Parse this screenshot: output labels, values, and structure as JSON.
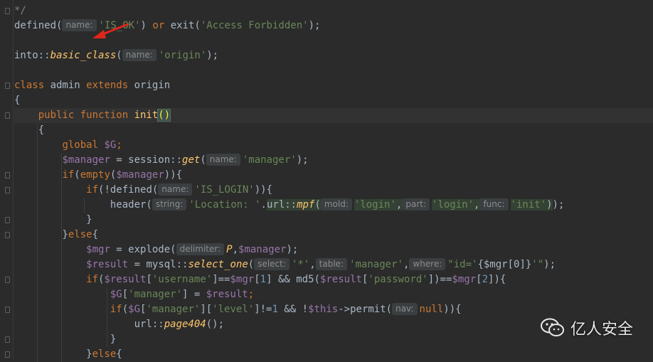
{
  "watermark": {
    "text": "亿人安全",
    "icon": "wechat-icon"
  },
  "colors": {
    "background": "#2b2b2b",
    "keyword": "#cc7832",
    "string": "#6a8759",
    "variable": "#9876aa",
    "function": "#ffc66d",
    "hint_bg": "#3b3f41",
    "arrow": "#e0261b"
  },
  "lines": [
    {
      "tokens": [
        {
          "t": "*/",
          "c": "cm"
        }
      ]
    },
    {
      "tokens": [
        {
          "t": "defined(",
          "c": "plain"
        },
        {
          "h": "name:"
        },
        {
          "t": "'IS_OK'",
          "c": "str"
        },
        {
          "t": ") ",
          "c": "plain"
        },
        {
          "t": "or ",
          "c": "kw"
        },
        {
          "t": "exit(",
          "c": "plain"
        },
        {
          "t": "'Access Forbidden'",
          "c": "str"
        },
        {
          "t": ");",
          "c": "plain"
        }
      ]
    },
    {
      "tokens": []
    },
    {
      "tokens": [
        {
          "t": "into::",
          "c": "plain"
        },
        {
          "t": "basic_class",
          "c": "ital"
        },
        {
          "t": "(",
          "c": "plain"
        },
        {
          "h": "name:"
        },
        {
          "t": "'origin'",
          "c": "str"
        },
        {
          "t": ");",
          "c": "plain"
        }
      ]
    },
    {
      "tokens": []
    },
    {
      "tokens": [
        {
          "t": "class ",
          "c": "kw"
        },
        {
          "t": "admin ",
          "c": "plain"
        },
        {
          "t": "extends ",
          "c": "kw"
        },
        {
          "t": "origin",
          "c": "plain"
        }
      ]
    },
    {
      "tokens": [
        {
          "t": "{",
          "c": "plain"
        }
      ]
    },
    {
      "current": true,
      "tokens": [
        {
          "t": "    ",
          "c": "plain"
        },
        {
          "t": "public function ",
          "c": "kw"
        },
        {
          "t": "init",
          "c": "fn"
        },
        {
          "t": "()",
          "c": "paren"
        }
      ]
    },
    {
      "tokens": [
        {
          "t": "    {",
          "c": "plain"
        }
      ]
    },
    {
      "tokens": [
        {
          "t": "        ",
          "c": "plain"
        },
        {
          "t": "global ",
          "c": "kw"
        },
        {
          "t": "$G",
          "c": "var"
        },
        {
          "t": ";",
          "c": "kw"
        }
      ]
    },
    {
      "tokens": [
        {
          "t": "        ",
          "c": "plain"
        },
        {
          "t": "$manager",
          "c": "var"
        },
        {
          "t": " = session::",
          "c": "plain"
        },
        {
          "t": "get",
          "c": "ital"
        },
        {
          "t": "(",
          "c": "plain"
        },
        {
          "h": "name:"
        },
        {
          "t": "'manager'",
          "c": "str"
        },
        {
          "t": ");",
          "c": "plain"
        }
      ]
    },
    {
      "tokens": [
        {
          "t": "        ",
          "c": "plain"
        },
        {
          "t": "if",
          "c": "kw"
        },
        {
          "t": "(",
          "c": "plain"
        },
        {
          "t": "empty",
          "c": "kw"
        },
        {
          "t": "(",
          "c": "plain"
        },
        {
          "t": "$manager",
          "c": "var"
        },
        {
          "t": ")){",
          "c": "plain"
        }
      ]
    },
    {
      "tokens": [
        {
          "t": "            ",
          "c": "plain"
        },
        {
          "t": "if",
          "c": "kw"
        },
        {
          "t": "(!defined(",
          "c": "plain"
        },
        {
          "h": "name:"
        },
        {
          "t": "'IS_LOGIN'",
          "c": "str"
        },
        {
          "t": ")){",
          "c": "plain"
        }
      ]
    },
    {
      "tokens": [
        {
          "t": "                header(",
          "c": "plain"
        },
        {
          "h": "string:"
        },
        {
          "t": "'Location: '",
          "c": "str"
        },
        {
          "t": ".",
          "c": "plain"
        },
        {
          "t": "url::",
          "c": "hlplain"
        },
        {
          "t": "mpf",
          "c": "hlital"
        },
        {
          "t": "(",
          "c": "hlplain"
        },
        {
          "h": "mold:"
        },
        {
          "t": "'login'",
          "c": "hlstr"
        },
        {
          "t": ",",
          "c": "hlplain"
        },
        {
          "h": "part:"
        },
        {
          "t": "'login'",
          "c": "hlstr"
        },
        {
          "t": ",",
          "c": "hlplain"
        },
        {
          "h": "func:"
        },
        {
          "t": "'init'",
          "c": "hlstr"
        },
        {
          "t": ")",
          "c": "hlplain"
        },
        {
          "t": ");",
          "c": "plain"
        }
      ]
    },
    {
      "tokens": [
        {
          "t": "            }",
          "c": "plain"
        }
      ]
    },
    {
      "tokens": [
        {
          "t": "        }",
          "c": "plain"
        },
        {
          "t": "else",
          "c": "kw"
        },
        {
          "t": "{",
          "c": "plain"
        }
      ]
    },
    {
      "tokens": [
        {
          "t": "            ",
          "c": "plain"
        },
        {
          "t": "$mgr",
          "c": "var"
        },
        {
          "t": " = explode(",
          "c": "plain"
        },
        {
          "h": "delimiter:"
        },
        {
          "t": "P",
          "c": "ital"
        },
        {
          "t": ",",
          "c": "plain"
        },
        {
          "t": "$manager",
          "c": "var"
        },
        {
          "t": ");",
          "c": "plain"
        }
      ]
    },
    {
      "tokens": [
        {
          "t": "            ",
          "c": "plain"
        },
        {
          "t": "$result",
          "c": "var"
        },
        {
          "t": " = mysql::",
          "c": "plain"
        },
        {
          "t": "select_one",
          "c": "ital"
        },
        {
          "t": "(",
          "c": "plain"
        },
        {
          "h": "select:"
        },
        {
          "t": "'*'",
          "c": "str"
        },
        {
          "t": ",",
          "c": "plain"
        },
        {
          "h": "table:"
        },
        {
          "t": "'manager'",
          "c": "str"
        },
        {
          "t": ",",
          "c": "plain"
        },
        {
          "h": "where:"
        },
        {
          "t": "\"id='",
          "c": "str"
        },
        {
          "t": "{$mgr[0]}",
          "c": "plain"
        },
        {
          "t": "'\"",
          "c": "str"
        },
        {
          "t": ");",
          "c": "plain"
        }
      ]
    },
    {
      "tokens": [
        {
          "t": "            ",
          "c": "plain"
        },
        {
          "t": "if",
          "c": "kw"
        },
        {
          "t": "(",
          "c": "plain"
        },
        {
          "t": "$result",
          "c": "var"
        },
        {
          "t": "[",
          "c": "plain"
        },
        {
          "t": "'username'",
          "c": "str"
        },
        {
          "t": "]==",
          "c": "plain"
        },
        {
          "t": "$mgr",
          "c": "var"
        },
        {
          "t": "[",
          "c": "plain"
        },
        {
          "t": "1",
          "c": "num"
        },
        {
          "t": "] && md5(",
          "c": "plain"
        },
        {
          "t": "$result",
          "c": "var"
        },
        {
          "t": "[",
          "c": "plain"
        },
        {
          "t": "'password'",
          "c": "str"
        },
        {
          "t": "])==",
          "c": "plain"
        },
        {
          "t": "$mgr",
          "c": "var"
        },
        {
          "t": "[",
          "c": "plain"
        },
        {
          "t": "2",
          "c": "num"
        },
        {
          "t": "]){",
          "c": "plain"
        }
      ]
    },
    {
      "tokens": [
        {
          "t": "                ",
          "c": "plain"
        },
        {
          "t": "$G",
          "c": "var"
        },
        {
          "t": "[",
          "c": "plain"
        },
        {
          "t": "'manager'",
          "c": "str"
        },
        {
          "t": "] = ",
          "c": "plain"
        },
        {
          "t": "$result",
          "c": "var"
        },
        {
          "t": ";",
          "c": "kw"
        }
      ]
    },
    {
      "tokens": [
        {
          "t": "                ",
          "c": "plain"
        },
        {
          "t": "if",
          "c": "kw"
        },
        {
          "t": "(",
          "c": "plain"
        },
        {
          "t": "$G",
          "c": "var"
        },
        {
          "t": "[",
          "c": "plain"
        },
        {
          "t": "'manager'",
          "c": "str"
        },
        {
          "t": "][",
          "c": "plain"
        },
        {
          "t": "'level'",
          "c": "str"
        },
        {
          "t": "]!=",
          "c": "plain"
        },
        {
          "t": "1",
          "c": "num"
        },
        {
          "t": " && !",
          "c": "plain"
        },
        {
          "t": "$this",
          "c": "var"
        },
        {
          "t": "->permit(",
          "c": "plain"
        },
        {
          "h": "nav:"
        },
        {
          "t": "null",
          "c": "kw"
        },
        {
          "t": ")){",
          "c": "plain"
        }
      ]
    },
    {
      "tokens": [
        {
          "t": "                    url::",
          "c": "plain"
        },
        {
          "t": "page404",
          "c": "ital"
        },
        {
          "t": "();",
          "c": "plain"
        }
      ]
    },
    {
      "tokens": [
        {
          "t": "                }",
          "c": "plain"
        }
      ]
    },
    {
      "tokens": [
        {
          "t": "            }",
          "c": "plain"
        },
        {
          "t": "else",
          "c": "kw"
        },
        {
          "t": "{",
          "c": "plain"
        }
      ]
    }
  ]
}
